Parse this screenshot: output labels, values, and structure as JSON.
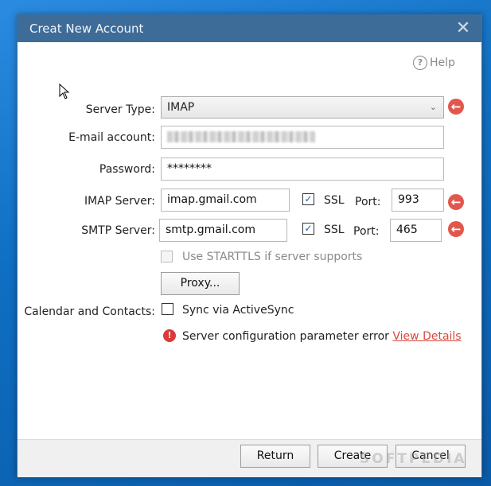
{
  "window": {
    "title": "Creat New Account",
    "close_glyph": "✕"
  },
  "help": {
    "label": "Help",
    "icon": "question-circle-icon",
    "glyph": "?"
  },
  "form": {
    "server_type": {
      "label": "Server Type:",
      "value": "IMAP"
    },
    "email": {
      "label": "E-mail account:"
    },
    "password": {
      "label": "Password:",
      "value": "********"
    },
    "imap": {
      "label": "IMAP Server:",
      "value": "imap.gmail.com",
      "ssl_label": "SSL",
      "ssl_checked": true,
      "port_label": "Port:",
      "port": "993"
    },
    "smtp": {
      "label": "SMTP Server:",
      "value": "smtp.gmail.com",
      "ssl_label": "SSL",
      "ssl_checked": true,
      "port_label": "Port:",
      "port": "465"
    },
    "starttls": {
      "label": "Use STARTTLS if server supports",
      "checked": false,
      "disabled": true
    },
    "proxy_button": "Proxy...",
    "calendar": {
      "label": "Calendar and Contacts:",
      "option": "Sync via ActiveSync",
      "checked": false
    }
  },
  "error": {
    "message": "Server configuration parameter error",
    "link": "View Details",
    "color": "#e2574c"
  },
  "buttons": {
    "return": "Return",
    "create": "Create",
    "cancel": "Cancel"
  },
  "watermark": "SOFTPEDIA",
  "colors": {
    "titlebar": "#3e6c99",
    "desktop": "#1378c9",
    "error": "#e2574c"
  }
}
